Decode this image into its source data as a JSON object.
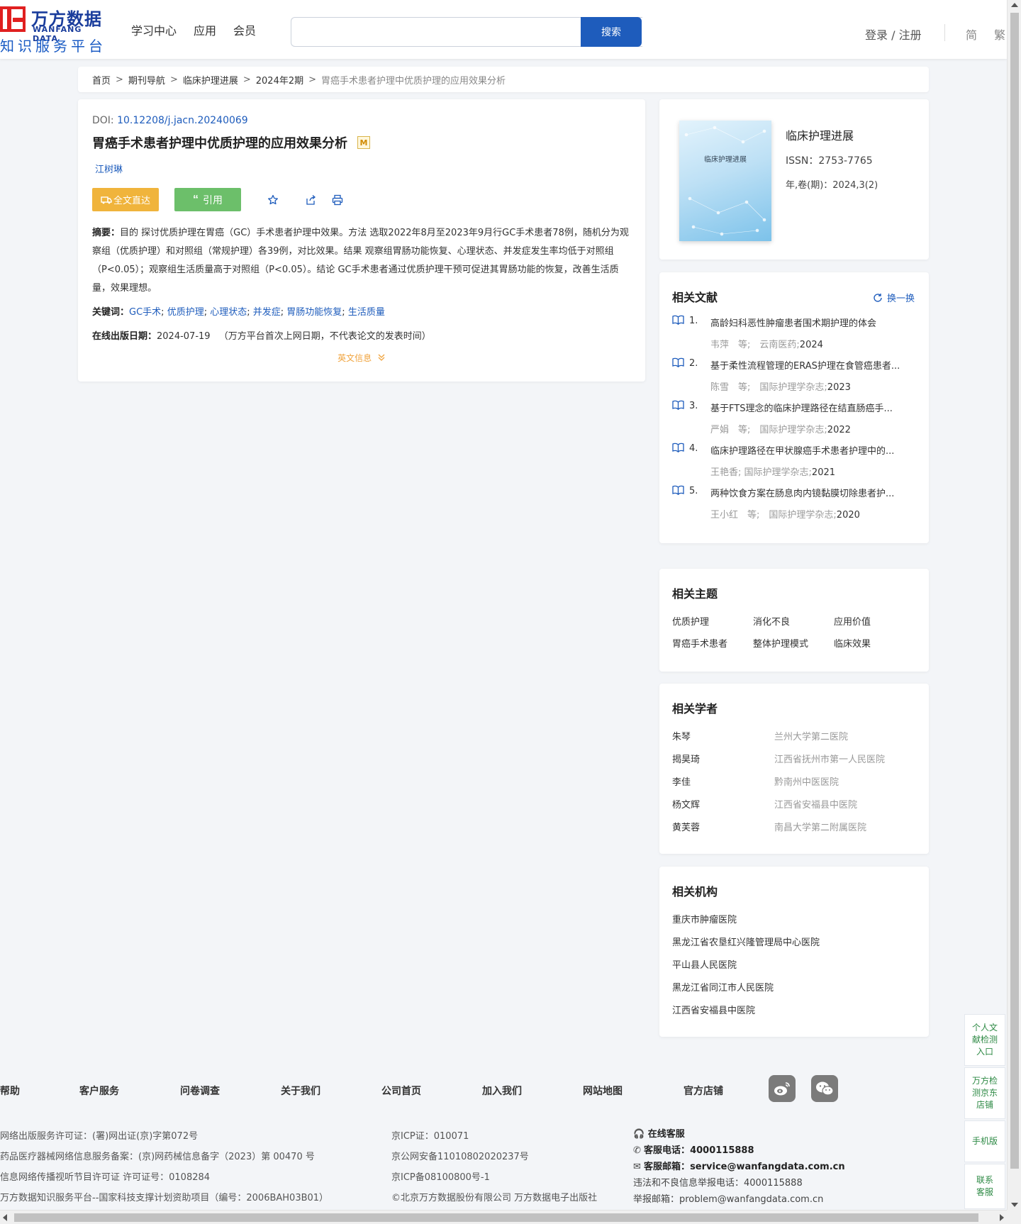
{
  "header": {
    "logo_cn": "万方数据",
    "logo_en": "WANFANG DATA",
    "logo_sub": "知识服务平台",
    "nav": [
      "学习中心",
      "应用",
      "会员"
    ],
    "search_placeholder": "",
    "search_button": "搜索",
    "login": "登录 / 注册",
    "lang_simplified": "简",
    "lang_traditional": "繁"
  },
  "breadcrumb": [
    "首页",
    "期刊导航",
    "临床护理进展",
    "2024年2期",
    "胃癌手术患者护理中优质护理的应用效果分析"
  ],
  "article": {
    "doi_label": "DOI: ",
    "doi": "10.12208/j.jacn.20240069",
    "title": "胃癌手术患者护理中优质护理的应用效果分析",
    "badge": "M",
    "author": "江树琳",
    "btn_fulltext": "全文直达",
    "btn_cite": "引用",
    "abstract_label": "摘要：",
    "abstract": "目的 探讨优质护理在胃癌（GC）手术患者护理中效果。方法 选取2022年8月至2023年9月行GC手术患者78例，随机分为观察组（优质护理）和对照组（常规护理）各39例，对比效果。结果 观察组胃肠功能恢复、心理状态、并发症发生率均低于对照组（P<0.05）；观察组生活质量高于对照组（P<0.05）。结论 GC手术患者通过优质护理干预可促进其胃肠功能的恢复，改善生活质量，效果理想。",
    "keywords_label": "关键词：",
    "keywords": [
      "GC手术",
      "优质护理",
      "心理状态",
      "并发症",
      "胃肠功能恢复",
      "生活质量"
    ],
    "pubdate_label": "在线出版日期：",
    "pubdate": "2024-07-19",
    "pubdate_note": "（万方平台首次上网日期，不代表论文的发表时间）",
    "en_info": "英文信息"
  },
  "journal": {
    "cover_title": "临床护理进展",
    "name": "临床护理进展",
    "issn": "ISSN：2753-7765",
    "volume": "年,卷(期)：2024,3(2)"
  },
  "related": {
    "title": "相关文献",
    "refresh": "换一换",
    "items": [
      {
        "num": "1.",
        "title": "高龄妇科恶性肿瘤患者围术期护理的体会",
        "authors": "韦萍　等;",
        "journal": "云南医药;",
        "year": "2024"
      },
      {
        "num": "2.",
        "title": "基于柔性流程管理的ERAS护理在食管癌患者...",
        "authors": "陈雪　等;",
        "journal": "国际护理学杂志;",
        "year": "2023"
      },
      {
        "num": "3.",
        "title": "基于FTS理念的临床护理路径在结直肠癌手...",
        "authors": "严娟　等;",
        "journal": "国际护理学杂志;",
        "year": "2022"
      },
      {
        "num": "4.",
        "title": "临床护理路径在甲状腺癌手术患者护理中的...",
        "authors": "王艳香;",
        "journal": "国际护理学杂志;",
        "year": "2021"
      },
      {
        "num": "5.",
        "title": "两种饮食方案在肠息肉内镜黏膜切除患者护...",
        "authors": "王小红　等;",
        "journal": "国际护理学杂志;",
        "year": "2020"
      }
    ]
  },
  "topics": {
    "title": "相关主题",
    "items": [
      "优质护理",
      "消化不良",
      "应用价值",
      "胃癌手术患者",
      "整体护理模式",
      "临床效果"
    ]
  },
  "scholars": {
    "title": "相关学者",
    "items": [
      {
        "name": "朱琴",
        "org": "兰州大学第二医院"
      },
      {
        "name": "揭昊琦",
        "org": "江西省抚州市第一人民医院"
      },
      {
        "name": "李佳",
        "org": "黔南州中医医院"
      },
      {
        "name": "杨文辉",
        "org": "江西省安福县中医院"
      },
      {
        "name": "黄芙蓉",
        "org": "南昌大学第二附属医院"
      }
    ]
  },
  "institutions": {
    "title": "相关机构",
    "items": [
      "重庆市肿瘤医院",
      "黑龙江省农垦红兴隆管理局中心医院",
      "平山县人民医院",
      "黑龙江省同江市人民医院",
      "江西省安福县中医院"
    ]
  },
  "float": [
    "个人文献检测入口",
    "万方检测京东店铺",
    "手机版",
    "联系客服"
  ],
  "footer": {
    "links": [
      "帮助",
      "客户服务",
      "问卷调查",
      "关于我们",
      "公司首页",
      "加入我们",
      "网站地图",
      "官方店铺"
    ],
    "col1": [
      "网络出版服务许可证：(署)网出证(京)字第072号",
      "药品医疗器械网络信息服务备案：(京)网药械信息备字（2023）第 00470 号",
      "信息网络传播视听节目许可证 许可证号：0108284",
      "万方数据知识服务平台--国家科技支撑计划资助项目（编号：2006BAH03B01）"
    ],
    "col2": [
      "京ICP证：010071",
      "京公网安备11010802020237号",
      "京ICP备08100800号-1",
      "©北京万方数据股份有限公司 万方数据电子出版社"
    ],
    "online_service": "在线客服",
    "phone_label": "客服电话：",
    "phone": "4000115888",
    "email_label": "客服邮箱：",
    "email": "service@wanfangdata.com.cn",
    "report_phone": "违法和不良信息举报电话：4000115888",
    "report_email": "举报邮箱：problem@wanfangdata.com.cn"
  }
}
